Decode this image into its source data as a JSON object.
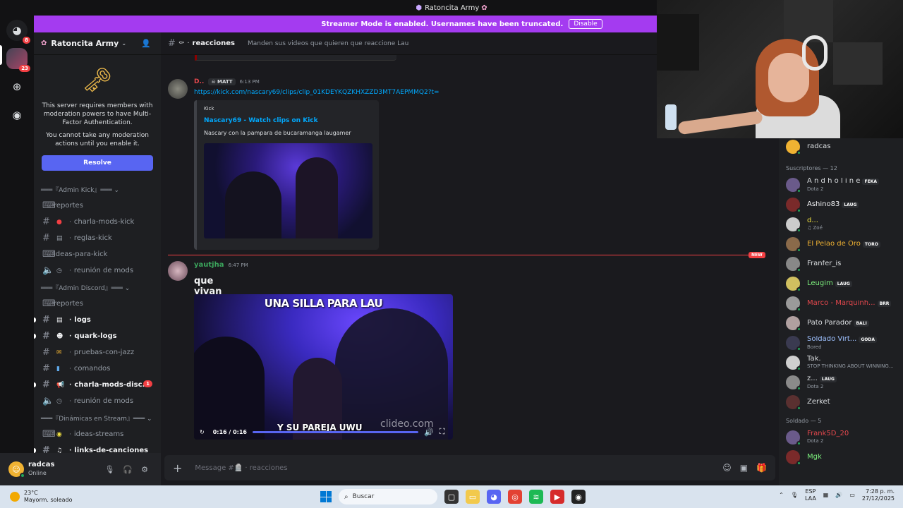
{
  "window": {
    "title": "Ratoncita Army"
  },
  "rail": {
    "home_badge": "8",
    "server_badge": "23"
  },
  "banner": {
    "text": "Streamer Mode is enabled. Usernames have been truncated.",
    "button": "Disable"
  },
  "server": {
    "name": "Ratoncita Army"
  },
  "mfa": {
    "line1": "This server requires members with moderation powers to have Multi-Factor Authentication.",
    "line2": "You cannot take any moderation actions until you enable it.",
    "button": "Resolve"
  },
  "channels": {
    "cat_admin_kick": "═══『Admin Kick』═══ ⌄",
    "reportes1": "reportes",
    "charla_mods_kick": "charla-mods-kick",
    "reglas_kick": "reglas-kick",
    "ideas_para_kick": "ideas-para-kick",
    "reunion1": "reunión de mods",
    "cat_admin_discord": "═══『Admin Discord』═══ ⌄",
    "reportes2": "reportes",
    "logs": "logs",
    "quark_logs": "quark-logs",
    "pruebas_con_jazz": "pruebas-con-jazz",
    "comandos": "comandos",
    "charla_mods_disc": "charla-mods-disc...",
    "charla_mods_disc_badge": "1",
    "reunion2": "reunión de mods",
    "cat_dinamicas": "═══『Dinámicas en Stream』═══ ⌄",
    "ideas_streams": "ideas-streams",
    "links_de_canciones": "links-de-canciones"
  },
  "user": {
    "name": "radcas",
    "status": "Online"
  },
  "chat": {
    "channel": "reacciones",
    "topic": "Manden sus videos que quieren que reaccione Lau",
    "msg1": {
      "author": "D..",
      "tag": "MATT",
      "time": "6:13 PM",
      "link": "https://kick.com/nascary69/clips/clip_01KDEYKQZKHXZZD3MT7AEPMMQ2?t=",
      "embed_provider": "Kick",
      "embed_title": "Nascary69 - Watch clips on Kick",
      "embed_desc": "Nascary con la pampara de bucaramanga laugamer"
    },
    "new_label": "NEW",
    "msg2": {
      "author": "yautjha",
      "time": "6:47 PM",
      "text": "que vivan las novias",
      "video_caption_top": "UNA SILLA PARA LAU",
      "video_caption_bottom": "Y SU PAREJA UWU",
      "video_watermark": "clideo.com",
      "video_time": "0:16 / 0:16"
    },
    "composer_placeholder": "Message #🪦 · reacciones"
  },
  "members": {
    "top_user": "radcas",
    "group1": "Suscriptores — 12",
    "list1": [
      {
        "name": "A n d h o l i n e",
        "tag": "FEKA",
        "activity": "Dota 2",
        "color": "#dbdee1"
      },
      {
        "name": "Ashino83",
        "tag": "LAUG",
        "activity": "",
        "color": "#f2f3f5"
      },
      {
        "name": "d...",
        "tag": "",
        "activity": "♫ Zoé",
        "color": "#f0e040"
      },
      {
        "name": "El Pelao de Oro",
        "tag": "TORO",
        "activity": "",
        "color": "#f0b232"
      },
      {
        "name": "Franfer_is",
        "tag": "",
        "activity": "",
        "color": "#dbdee1"
      },
      {
        "name": "Leugim",
        "tag": "LAUG",
        "activity": "",
        "color": "#7df07d"
      },
      {
        "name": "Marco - Marquinh...",
        "tag": "BRR",
        "activity": "",
        "color": "#e5484d"
      },
      {
        "name": "Pato Parador",
        "tag": "BALI",
        "activity": "",
        "color": "#dbdee1"
      },
      {
        "name": "Soldado Virt...",
        "tag": "GODA",
        "activity": "Bored",
        "color": "#9ec1ff"
      },
      {
        "name": "Tak.",
        "tag": "",
        "activity": "STOP THINKING ABOUT WINNING...",
        "color": "#dbdee1"
      },
      {
        "name": "z...",
        "tag": "LAUG",
        "activity": "Dota 2",
        "color": "#dbdee1"
      },
      {
        "name": "Zerket",
        "tag": "",
        "activity": "",
        "color": "#dbdee1"
      }
    ],
    "group2": "Soldado — 5",
    "list2": [
      {
        "name": "Frank5D_20",
        "tag": "",
        "activity": "Dota 2",
        "color": "#e5484d"
      },
      {
        "name": "Mgk",
        "tag": "",
        "activity": "",
        "color": "#7df07d"
      }
    ]
  },
  "taskbar": {
    "weather_temp": "23°C",
    "weather_desc": "Mayorm. soleado",
    "search": "Buscar",
    "lang1": "ESP",
    "lang2": "LAA",
    "time": "7:28 p. m.",
    "date": "27/12/2025"
  }
}
